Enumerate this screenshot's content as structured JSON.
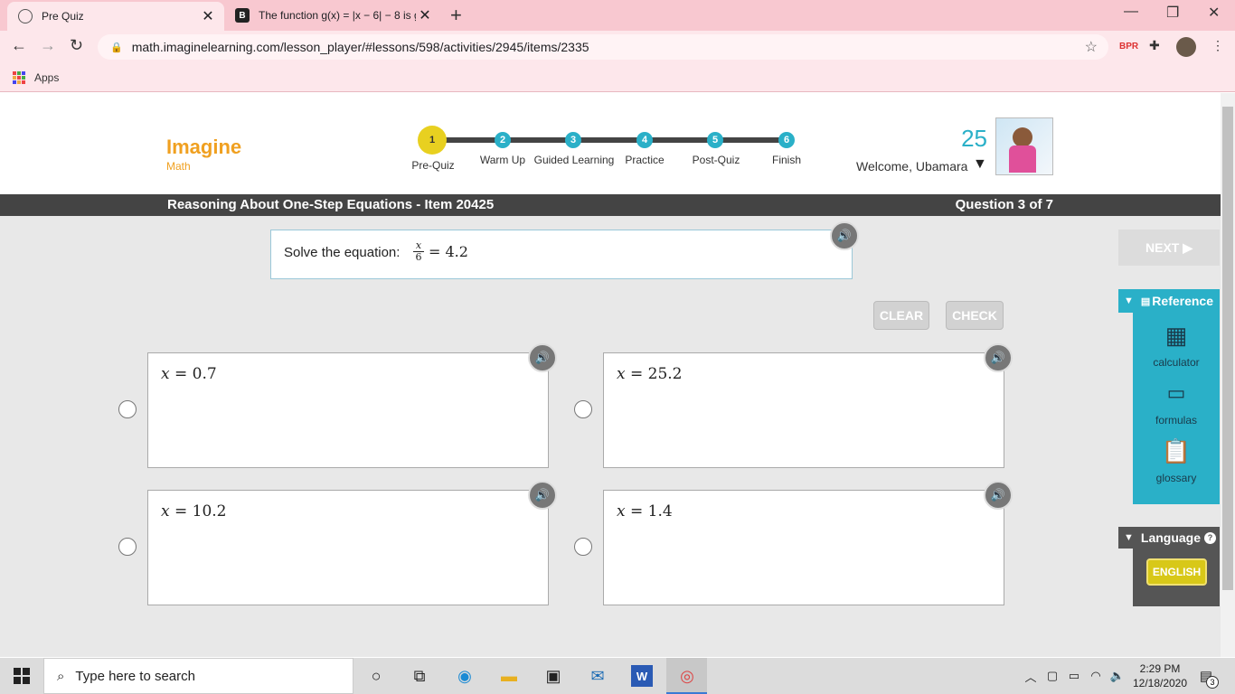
{
  "browser": {
    "tabs": [
      {
        "title": "Pre Quiz",
        "active": true
      },
      {
        "title": "The function g(x) = |x − 6| − 8 is g",
        "active": false
      }
    ],
    "url": "math.imaginelearning.com/lesson_player/#lessons/598/activities/2945/items/2335",
    "bookmarks_apps_label": "Apps"
  },
  "header": {
    "logo_title": "Imagine",
    "logo_sub": "Math",
    "steps": [
      {
        "number": "1",
        "label": "Pre-Quiz",
        "current": true
      },
      {
        "number": "2",
        "label": "Warm Up"
      },
      {
        "number": "3",
        "label": "Guided Learning"
      },
      {
        "number": "4",
        "label": "Practice"
      },
      {
        "number": "5",
        "label": "Post-Quiz"
      },
      {
        "number": "6",
        "label": "Finish"
      }
    ],
    "points": "25",
    "welcome": "Welcome, Ubamara"
  },
  "titlebar": {
    "lesson_title": "Reasoning About One-Step Equations - Item 20425",
    "question_counter": "Question 3 of 7"
  },
  "question": {
    "prompt": "Solve the equation:",
    "fraction_numerator": "x",
    "fraction_denominator": "6",
    "equation_rest": "= 4.2"
  },
  "actions": {
    "clear_label": "CLEAR",
    "check_label": "CHECK",
    "next_label": "NEXT ▶"
  },
  "choices": [
    {
      "text": "x = 0.7"
    },
    {
      "text": "x = 25.2"
    },
    {
      "text": "x = 10.2"
    },
    {
      "text": "x = 1.4"
    }
  ],
  "reference": {
    "title": "Reference",
    "tools": [
      {
        "label": "calculator",
        "icon": "calculator-icon"
      },
      {
        "label": "formulas",
        "icon": "formulas-icon"
      },
      {
        "label": "glossary",
        "icon": "glossary-icon"
      }
    ]
  },
  "language": {
    "title": "Language",
    "button_label": "ENGLISH"
  },
  "taskbar": {
    "search_placeholder": "Type here to search",
    "time": "2:29 PM",
    "date": "12/18/2020",
    "notification_count": "3"
  },
  "colors": {
    "accent_teal": "#2ab0c8",
    "current_step_yellow": "#e8d020",
    "logo_orange": "#f0a020",
    "titlebar_dark": "#444444"
  }
}
